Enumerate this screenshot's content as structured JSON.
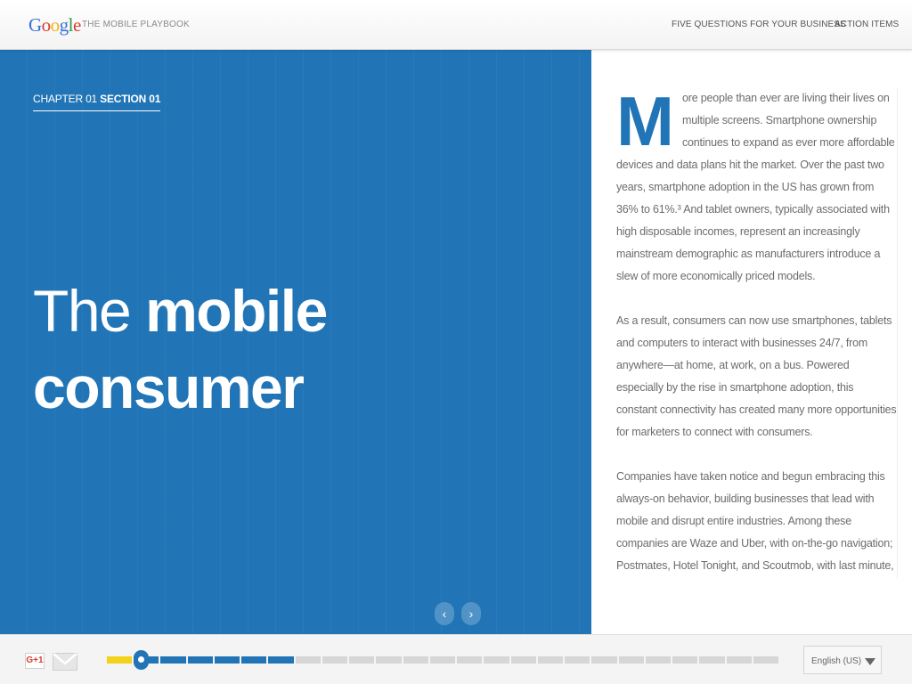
{
  "header": {
    "logo": "Google",
    "site_title": "THE MOBILE PLAYBOOK",
    "nav": [
      {
        "label": "FIVE QUESTIONS FOR YOUR BUSINESS"
      },
      {
        "label": "ACTION ITEMS"
      }
    ]
  },
  "hero": {
    "chapter_prefix": "CHAPTER 01",
    "chapter_section": "SECTION 01",
    "title_light": "The",
    "title_bold_1": "mobile",
    "title_bold_2": "consumer",
    "background_color": "#2175b6",
    "prev_icon": "chevron-left-icon",
    "next_icon": "chevron-right-icon",
    "prev_glyph": "‹",
    "next_glyph": "›"
  },
  "article": {
    "drop_cap": "M",
    "paragraphs": [
      "ore people than ever are living their lives on multiple screens. Smartphone ownership continues to expand as ever more affordable devices and data plans hit the market. Over the past two years, smartphone adoption in the US has grown from 36% to 61%.³ And tablet owners, typically associated with high disposable incomes, represent an increasingly mainstream demographic as manufacturers introduce a slew of more economically priced models.",
      "As a result, consumers can now use smartphones, tablets and computers to interact with businesses 24/7, from anywhere—at home, at work, on a bus. Powered especially by the rise in smartphone adoption, this constant connectivity has created many more opportunities for marketers to connect with consumers.",
      "Companies have taken notice and begun embracing this always-on behavior, building businesses that lead with mobile and disrupt entire industries. Among these companies are Waze and Uber, with on-the-go navigation; Postmates, Hotel Tonight, and Scoutmob, with last minute, around the corner"
    ]
  },
  "footer": {
    "gplus_label": "G+1",
    "mail_icon": "mail-icon",
    "progress": {
      "segments_total": 25,
      "segments_completed": 7,
      "current_position_fraction": 0.05,
      "colors": {
        "yellow": "#f2d21a",
        "blue": "#2175b6",
        "gray": "#d6d6d6"
      }
    },
    "language": "English (US)"
  }
}
